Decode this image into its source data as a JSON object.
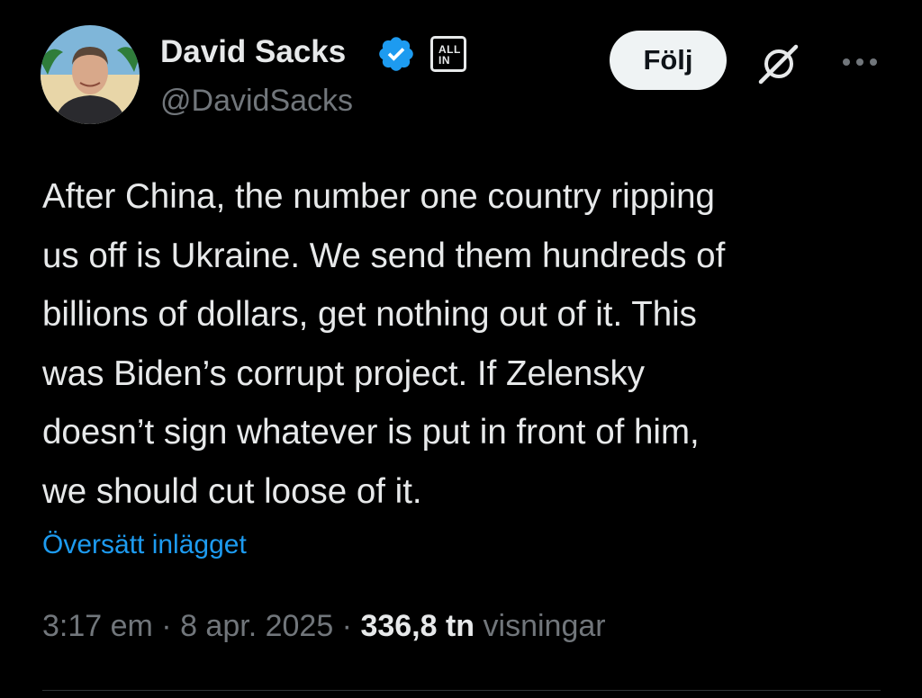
{
  "author": {
    "display_name": "David Sacks",
    "handle": "@DavidSacks",
    "affiliate_badge": [
      "ALL",
      "IN"
    ],
    "verified_color": "#1d9bf0"
  },
  "actions": {
    "follow_label": "Följ",
    "grok_icon": "grok-icon",
    "more_icon": "more-icon"
  },
  "tweet": {
    "lines": [
      "After China, the number one country ripping",
      "us off is Ukraine. We send them hundreds of",
      "billions of dollars, get nothing out of it. This",
      "was Biden’s corrupt project. If Zelensky",
      "doesn’t sign whatever is put in front of him,",
      "we should cut loose of it."
    ],
    "translate_label": "Översätt inlägget"
  },
  "meta": {
    "time": "3:17 em",
    "separator": " · ",
    "date": "8 apr. 2025",
    "view_count": "336,8 tn",
    "views_label": "visningar"
  },
  "colors": {
    "background": "#000000",
    "text": "#e7e9ea",
    "secondary": "#71767b",
    "link": "#1d9bf0"
  }
}
